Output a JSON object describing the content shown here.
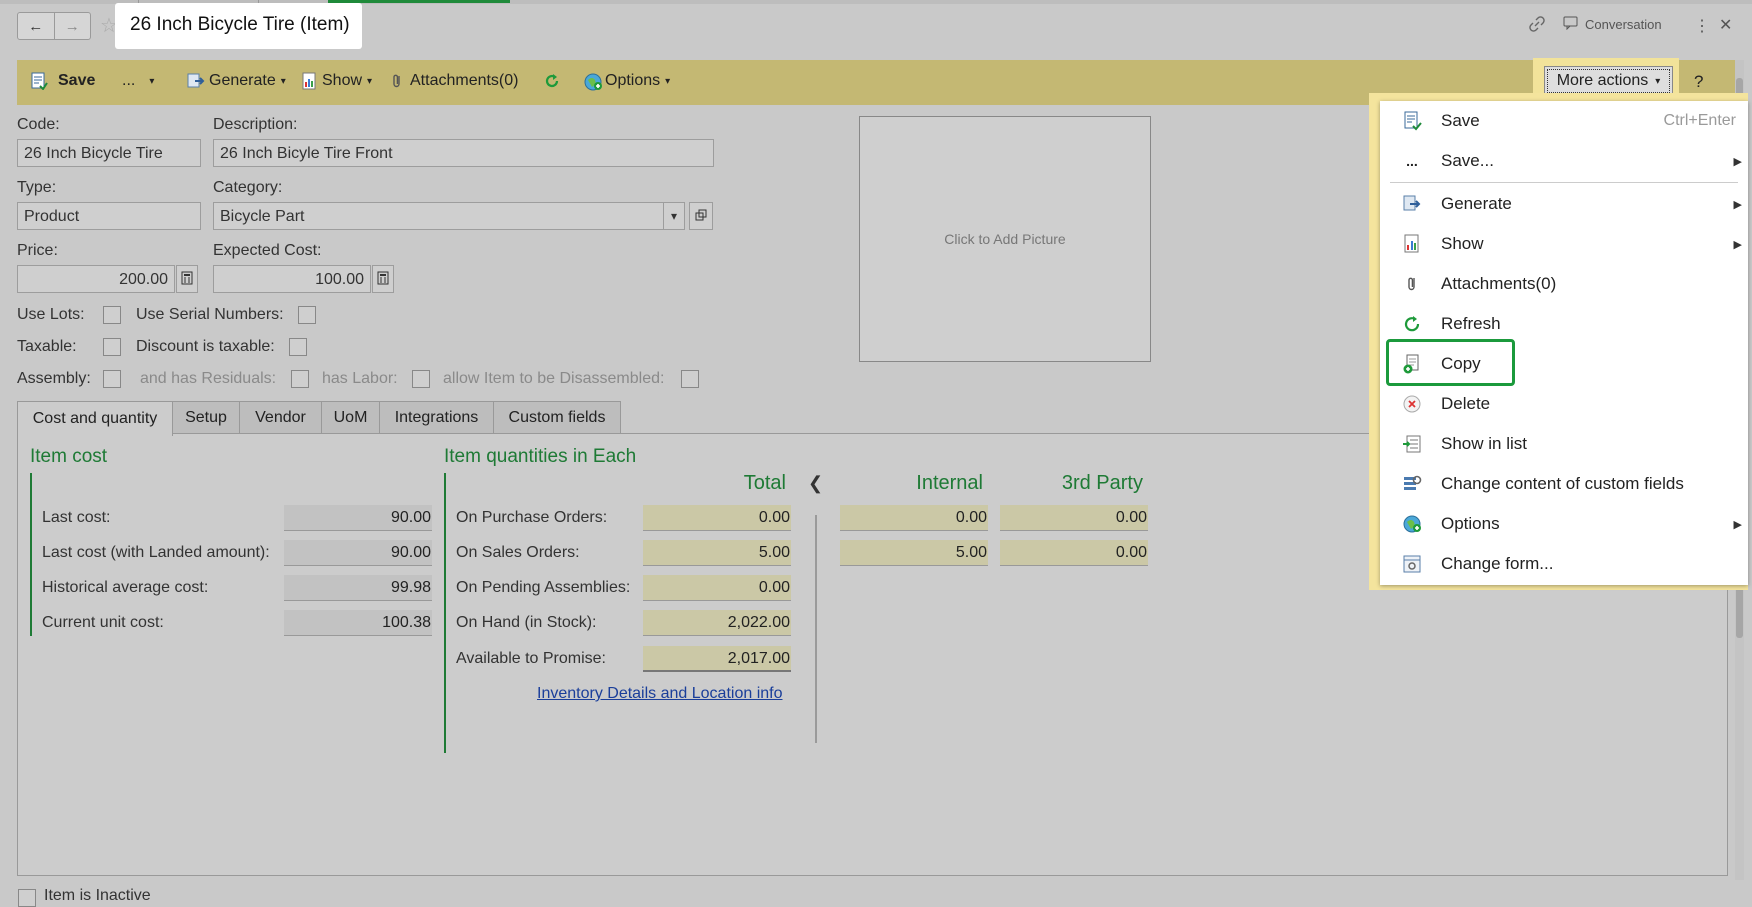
{
  "window": {
    "title": "26 Inch Bicycle Tire (Item)",
    "conversation_label": "Conversation"
  },
  "toolbar": {
    "save_label": "Save",
    "more_save_label": "...",
    "generate_label": "Generate",
    "show_label": "Show",
    "attachments_label": "Attachments(0)",
    "options_label": "Options",
    "more_actions_label": "More actions",
    "help_label": "?"
  },
  "form": {
    "code_label": "Code:",
    "code_value": "26 Inch Bicycle Tire",
    "description_label": "Description:",
    "description_value": "26 Inch Bicyle Tire Front",
    "type_label": "Type:",
    "type_value": "Product",
    "category_label": "Category:",
    "category_value": "Bicycle Part",
    "price_label": "Price:",
    "price_value": "200.00",
    "expected_cost_label": "Expected Cost:",
    "expected_cost_value": "100.00",
    "use_lots_label": "Use Lots:",
    "use_serial_label": "Use Serial Numbers:",
    "taxable_label": "Taxable:",
    "discount_taxable_label": "Discount is taxable:",
    "assembly_label": "Assembly:",
    "has_residuals_label": "and has Residuals:",
    "has_labor_label": "has Labor:",
    "allow_disassembled_label": "allow Item to be Disassembled:",
    "picture_placeholder": "Click to Add Picture",
    "inactive_label": "Item is Inactive"
  },
  "tabs": [
    {
      "label": "Cost and quantity"
    },
    {
      "label": "Setup"
    },
    {
      "label": "Vendor"
    },
    {
      "label": "UoM"
    },
    {
      "label": "Integrations"
    },
    {
      "label": "Custom fields"
    }
  ],
  "item_cost": {
    "title": "Item cost",
    "rows": [
      {
        "label": "Last cost:",
        "value": "90.00"
      },
      {
        "label": "Last cost (with Landed amount):",
        "value": "90.00"
      },
      {
        "label": "Historical average cost:",
        "value": "99.98"
      },
      {
        "label": "Current unit cost:",
        "value": "100.38"
      }
    ]
  },
  "item_quantities": {
    "title": "Item quantities in Each",
    "col_total": "Total",
    "col_internal": "Internal",
    "col_third_party": "3rd Party",
    "collapse_icon": "chevron-left-icon",
    "rows": [
      {
        "label": "On Purchase Orders:",
        "total": "0.00",
        "internal": "0.00",
        "third_party": "0.00"
      },
      {
        "label": "On Sales Orders:",
        "total": "5.00",
        "internal": "5.00",
        "third_party": "0.00"
      },
      {
        "label": "On Pending Assemblies:",
        "total": "0.00"
      },
      {
        "label": "On Hand (in Stock):",
        "total": "2,022.00"
      },
      {
        "label": "Available to Promise:",
        "total": "2,017.00"
      }
    ],
    "inventory_link": "Inventory Details and Location info"
  },
  "menu": {
    "items": [
      {
        "label": "Save",
        "shortcut": "Ctrl+Enter",
        "icon": "save-icon"
      },
      {
        "label": "Save...",
        "icon": "ellipsis-icon",
        "submenu": true
      },
      {
        "label": "Generate",
        "icon": "generate-icon",
        "submenu": true
      },
      {
        "label": "Show",
        "icon": "report-icon",
        "submenu": true
      },
      {
        "label": "Attachments(0)",
        "icon": "paperclip-icon"
      },
      {
        "label": "Refresh",
        "icon": "refresh-icon"
      },
      {
        "label": "Copy",
        "icon": "copy-icon"
      },
      {
        "label": "Delete",
        "icon": "delete-icon"
      },
      {
        "label": "Show in list",
        "icon": "list-icon"
      },
      {
        "label": "Change content of custom fields",
        "icon": "custom-fields-icon"
      },
      {
        "label": "Options",
        "icon": "options-icon",
        "submenu": true
      },
      {
        "label": "Change form...",
        "icon": "form-icon"
      }
    ]
  },
  "colors": {
    "toolbar_bg": "#c4b873",
    "accent_green": "#1e7a35",
    "highlight_green": "#1b9a3c",
    "menu_frame": "#f4e49d"
  }
}
